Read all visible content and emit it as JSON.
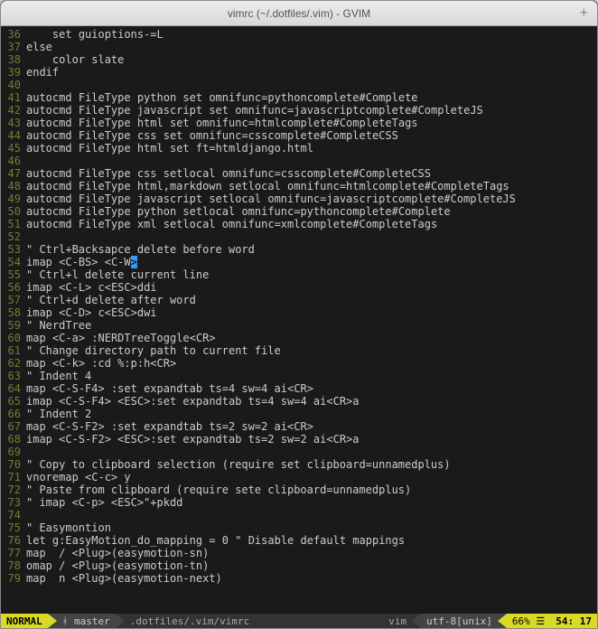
{
  "window": {
    "title": "vimrc (~/.dotfiles/.vim) - GVIM"
  },
  "lines": [
    {
      "n": 36,
      "h": "    <kw>set</kw> <opt>guioptions</opt>-=L"
    },
    {
      "n": 37,
      "h": "<stmt>else</stmt>"
    },
    {
      "n": 38,
      "h": "    <kw>color</kw> slate"
    },
    {
      "n": 39,
      "h": "<stmt>endif</stmt>"
    },
    {
      "n": 40,
      "h": ""
    },
    {
      "n": 41,
      "h": "<stmt>autocmd</stmt> <opt>FileType</opt> python <kw>set</kw> <opt>omnifunc</opt>=pythoncomplete#Complete"
    },
    {
      "n": 42,
      "h": "<stmt>autocmd</stmt> <opt>FileType</opt> javascript <kw>set</kw> <opt>omnifunc</opt>=javascriptcomplete#CompleteJS"
    },
    {
      "n": 43,
      "h": "<stmt>autocmd</stmt> <opt>FileType</opt> html <kw>set</kw> <opt>omnifunc</opt>=htmlcomplete#CompleteTags"
    },
    {
      "n": 44,
      "h": "<stmt>autocmd</stmt> <opt>FileType</opt> css <kw>set</kw> <opt>omnifunc</opt>=csscomplete#CompleteCSS"
    },
    {
      "n": 45,
      "h": "<stmt>autocmd</stmt> <opt>FileType</opt> html <kw>set</kw> <opt>ft</opt>=htmldjango.html"
    },
    {
      "n": 46,
      "h": ""
    },
    {
      "n": 47,
      "h": "<stmt>autocmd</stmt> <opt>FileType</opt> css <kw>setlocal</kw> <opt>omnifunc</opt>=csscomplete#CompleteCSS"
    },
    {
      "n": 48,
      "h": "<stmt>autocmd</stmt> <opt>FileType</opt> html,markdown <kw>setlocal</kw> <opt>omnifunc</opt>=htmlcomplete#CompleteTags"
    },
    {
      "n": 49,
      "h": "<stmt>autocmd</stmt> <opt>FileType</opt> javascript <kw>setlocal</kw> <opt>omnifunc</opt>=javascriptcomplete#CompleteJS"
    },
    {
      "n": 50,
      "h": "<stmt>autocmd</stmt> <opt>FileType</opt> python <kw>setlocal</kw> <opt>omnifunc</opt>=pythoncomplete#Complete"
    },
    {
      "n": 51,
      "h": "<stmt>autocmd</stmt> <opt>FileType</opt> xml <kw>setlocal</kw> <opt>omnifunc</opt>=xmlcomplete#CompleteTags"
    },
    {
      "n": 52,
      "h": ""
    },
    {
      "n": 53,
      "h": "<cm>\" Ctrl+Backsapce delete before word</cm>"
    },
    {
      "n": 54,
      "h": "<stmt>imap</stmt> <sp>&lt;C-BS&gt;</sp> <sp>&lt;C-W<span class='cursor'>&gt;</span></sp>"
    },
    {
      "n": 55,
      "h": "<cm>\" Ctrl+l delete current line</cm>"
    },
    {
      "n": 56,
      "h": "<stmt>imap</stmt> <sp>&lt;C-L&gt;</sp> c<sp>&lt;ESC&gt;</sp>ddi"
    },
    {
      "n": 57,
      "h": "<cm>\" Ctrl+d delete after word</cm>"
    },
    {
      "n": 58,
      "h": "<stmt>imap</stmt> <sp>&lt;C-D&gt;</sp> c<sp>&lt;ESC&gt;</sp>dwi"
    },
    {
      "n": 59,
      "h": "<cm>\" NerdTree</cm>"
    },
    {
      "n": 60,
      "h": "<stmt>map</stmt> <sp>&lt;C-a&gt;</sp> :NERDTreeToggle<sp>&lt;CR&gt;</sp>"
    },
    {
      "n": 61,
      "h": "<cm>\" Change directory path to current file</cm>"
    },
    {
      "n": 62,
      "h": "<stmt>map</stmt> <sp>&lt;C-k&gt;</sp> :cd %:p:h<sp>&lt;CR&gt;</sp>"
    },
    {
      "n": 63,
      "h": "<cm>\" Indent 4</cm>"
    },
    {
      "n": 64,
      "h": "<stmt>map</stmt> <sp>&lt;C-S-F4&gt;</sp> :set expandtab ts=4 sw=4 ai<sp>&lt;CR&gt;</sp>"
    },
    {
      "n": 65,
      "h": "<stmt>imap</stmt> <sp>&lt;C-S-F4&gt;</sp> <sp>&lt;ESC&gt;</sp>:set expandtab ts=4 sw=4 ai<sp>&lt;CR&gt;</sp>a"
    },
    {
      "n": 66,
      "h": "<cm>\" Indent 2</cm>"
    },
    {
      "n": 67,
      "h": "<stmt>map</stmt> <sp>&lt;C-S-F2&gt;</sp> :set expandtab ts=2 sw=2 ai<sp>&lt;CR&gt;</sp>"
    },
    {
      "n": 68,
      "h": "<stmt>imap</stmt> <sp>&lt;C-S-F2&gt;</sp> <sp>&lt;ESC&gt;</sp>:set expandtab ts=2 sw=2 ai<sp>&lt;CR&gt;</sp>a"
    },
    {
      "n": 69,
      "h": ""
    },
    {
      "n": 70,
      "h": "<cm>\" Copy to clipboard selection (require set clipboard=unnamedplus)</cm>"
    },
    {
      "n": 71,
      "h": "<stmt>vnoremap</stmt> <sp>&lt;C-c&gt;</sp> y"
    },
    {
      "n": 72,
      "h": "<cm>\" Paste from clipboard (require sete clipboard=unnamedplus)</cm>"
    },
    {
      "n": 73,
      "h": "<cm>\" imap &lt;C-p&gt; &lt;ESC&gt;\"+pkdd</cm>"
    },
    {
      "n": 74,
      "h": ""
    },
    {
      "n": 75,
      "h": "<cm>\" Easymontion</cm>"
    },
    {
      "n": 76,
      "h": "<stmt>let</stmt> <opt>g:EasyMotion_do_mapping</opt> = <lit>0</lit> <cm>\" Disable default mappings</cm>"
    },
    {
      "n": 77,
      "h": "<stmt>map</stmt>  / <sp>&lt;Plug&gt;</sp>(easymotion-sn)"
    },
    {
      "n": 78,
      "h": "<stmt>omap</stmt> / <sp>&lt;Plug&gt;</sp>(easymotion-tn)"
    },
    {
      "n": 79,
      "h": "<stmt>map</stmt>  n <sp>&lt;Plug&gt;</sp>(easymotion-next)"
    }
  ],
  "status": {
    "mode": "NORMAL",
    "branch_icon": "ᚼ",
    "branch": "master",
    "path": ".dotfiles/.vim/vimrc",
    "filetype": "vim",
    "encoding": "utf-8[unix]",
    "scroll": "66% ☰",
    "pos": "54: 17"
  }
}
